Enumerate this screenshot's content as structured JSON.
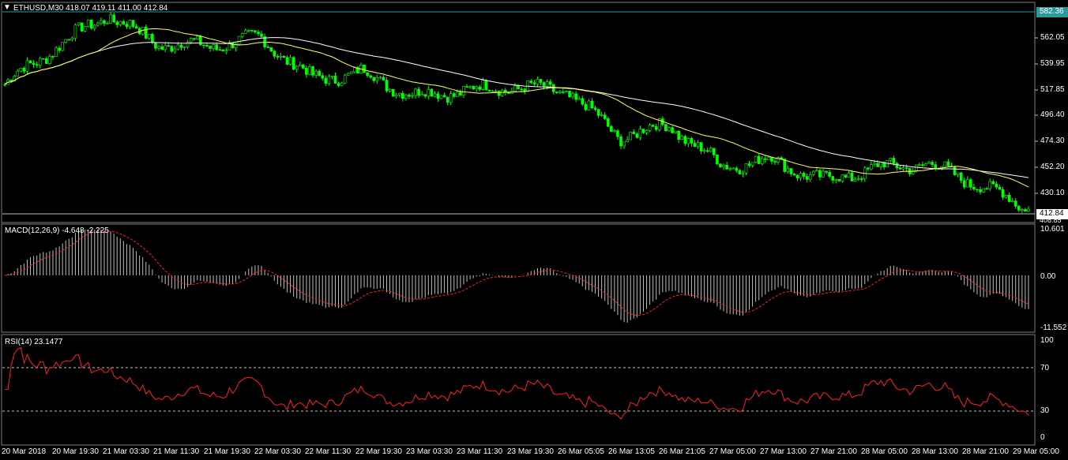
{
  "window": {
    "symbol_header": "ETHUSD,M30  418.07 419.11 411.00 412.84"
  },
  "price_axis": {
    "ticks": [
      "562.05",
      "539.95",
      "517.85",
      "496.40",
      "474.30",
      "452.20",
      "430.10"
    ],
    "top_marker": "582.36",
    "last_price": "412.84",
    "under_label": "408.85"
  },
  "macd": {
    "header": "MACD(12,26,9) -4.648 -2.225",
    "ticks": [
      "10.601",
      "0.00",
      "-11.552"
    ]
  },
  "rsi": {
    "header": "RSI(14) 23.1477",
    "ticks": [
      "100",
      "70",
      "30",
      "0"
    ]
  },
  "time_axis": {
    "labels": [
      "20 Mar 2018",
      "20 Mar 19:30",
      "21 Mar 03:30",
      "21 Mar 11:30",
      "21 Mar 19:30",
      "22 Mar 03:30",
      "22 Mar 11:30",
      "22 Mar 19:30",
      "23 Mar 03:30",
      "23 Mar 11:30",
      "23 Mar 19:30",
      "26 Mar 05:05",
      "26 Mar 13:05",
      "26 Mar 21:05",
      "27 Mar 05:00",
      "27 Mar 13:00",
      "27 Mar 21:00",
      "28 Mar 05:00",
      "28 Mar 13:00",
      "28 Mar 21:00",
      "29 Mar 05:00"
    ]
  },
  "colors": {
    "background": "#000000",
    "candles": "#00ff00",
    "ma_fast": "#ffff66",
    "ma_slow": "#ffffff",
    "macd_histogram": "#c0c0c0",
    "macd_signal": "#ff2020",
    "rsi_line": "#ff2020",
    "grid": "#808080"
  },
  "chart_data": {
    "type": "line",
    "title": "ETHUSD,M30",
    "price_key_points": [
      {
        "x": "20 Mar 2018",
        "close": 520
      },
      {
        "x": "20 Mar 19:30",
        "close": 552
      },
      {
        "x": "21 Mar 03:30",
        "close": 580
      },
      {
        "x": "21 Mar 11:30",
        "close": 555
      },
      {
        "x": "21 Mar 19:30",
        "close": 553
      },
      {
        "x": "22 Mar 03:30",
        "close": 560
      },
      {
        "x": "22 Mar 11:30",
        "close": 525
      },
      {
        "x": "22 Mar 19:30",
        "close": 530
      },
      {
        "x": "23 Mar 03:30",
        "close": 510
      },
      {
        "x": "23 Mar 11:30",
        "close": 515
      },
      {
        "x": "23 Mar 19:30",
        "close": 518
      },
      {
        "x": "26 Mar 05:05",
        "close": 514
      },
      {
        "x": "26 Mar 13:05",
        "close": 475
      },
      {
        "x": "26 Mar 21:05",
        "close": 485
      },
      {
        "x": "27 Mar 05:00",
        "close": 450
      },
      {
        "x": "27 Mar 13:00",
        "close": 455
      },
      {
        "x": "27 Mar 21:00",
        "close": 437
      },
      {
        "x": "28 Mar 05:00",
        "close": 448
      },
      {
        "x": "28 Mar 13:00",
        "close": 452
      },
      {
        "x": "28 Mar 21:00",
        "close": 435
      },
      {
        "x": "29 Mar 05:00",
        "close": 412.84
      }
    ],
    "ylim": [
      408.85,
      582.36
    ],
    "macd_last": -4.648,
    "macd_signal_last": -2.225,
    "rsi_last": 23.1477,
    "rsi_levels": [
      70,
      30
    ]
  }
}
